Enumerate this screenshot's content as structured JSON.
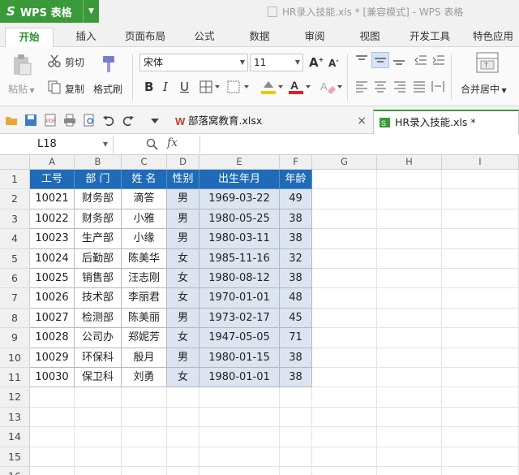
{
  "app": {
    "name": "WPS 表格",
    "logo": "S",
    "document_title": "HR录入技能.xls * [兼容模式] - WPS 表格"
  },
  "ribbon_tabs": [
    "开始",
    "插入",
    "页面布局",
    "公式",
    "数据",
    "审阅",
    "视图",
    "开发工具",
    "特色应用"
  ],
  "ribbon": {
    "cut": "剪切",
    "paste": "粘贴",
    "copy": "复制",
    "format_painter": "格式刷",
    "font_name": "宋体",
    "font_size": "11",
    "merge_center": "合并居中"
  },
  "doc_tabs": [
    {
      "label": "部落窝教育.xlsx",
      "close": "×"
    },
    {
      "label": "HR录入技能.xls *"
    }
  ],
  "formula_bar": {
    "name_box": "L18",
    "fx": "fx",
    "formula": ""
  },
  "columns": [
    "A",
    "B",
    "C",
    "D",
    "E",
    "F",
    "G",
    "H",
    "I"
  ],
  "rows": [
    "1",
    "2",
    "3",
    "4",
    "5",
    "6",
    "7",
    "8",
    "9",
    "10",
    "11",
    "12",
    "13",
    "14",
    "15",
    "16"
  ],
  "table": {
    "headers": [
      "工号",
      "部 门",
      "姓 名",
      "性别",
      "出生年月",
      "年龄"
    ],
    "rows": [
      [
        "10021",
        "财务部",
        "滴答",
        "男",
        "1969-03-22",
        "49"
      ],
      [
        "10022",
        "财务部",
        "小雅",
        "男",
        "1980-05-25",
        "38"
      ],
      [
        "10023",
        "生产部",
        "小缘",
        "男",
        "1980-03-11",
        "38"
      ],
      [
        "10024",
        "后勤部",
        "陈美华",
        "女",
        "1985-11-16",
        "32"
      ],
      [
        "10025",
        "销售部",
        "汪志刚",
        "女",
        "1980-08-12",
        "38"
      ],
      [
        "10026",
        "技术部",
        "李丽君",
        "女",
        "1970-01-01",
        "48"
      ],
      [
        "10027",
        "检测部",
        "陈美丽",
        "男",
        "1973-02-17",
        "45"
      ],
      [
        "10028",
        "公司办",
        "郑妮芳",
        "女",
        "1947-05-05",
        "71"
      ],
      [
        "10029",
        "环保科",
        "殷月",
        "男",
        "1980-01-15",
        "38"
      ],
      [
        "10030",
        "保卫科",
        "刘勇",
        "女",
        "1980-01-01",
        "38"
      ]
    ]
  },
  "colors": {
    "brand_green": "#3a9a3a",
    "header_blue": "#1f6bb8",
    "selection_fill": "#dbe4f0"
  }
}
